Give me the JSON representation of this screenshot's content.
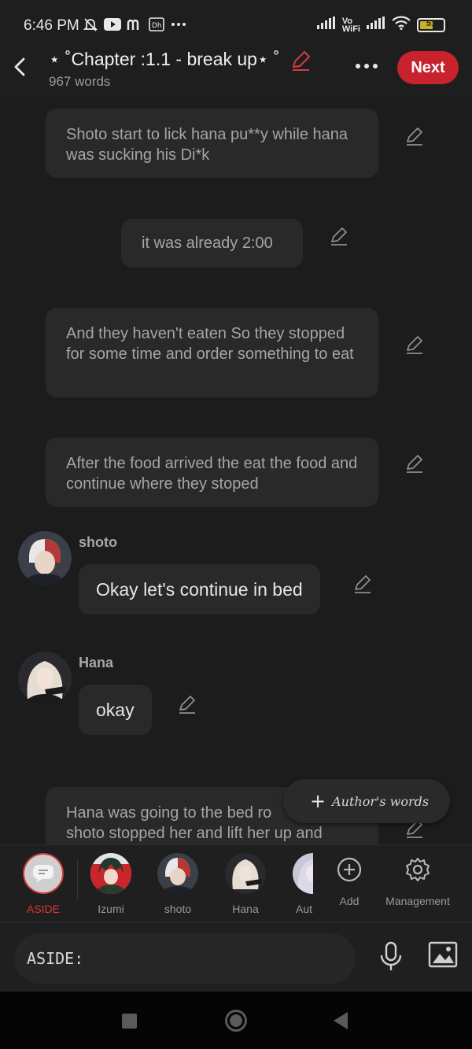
{
  "status_bar": {
    "time": "6:46 PM",
    "vowifi": "Vo\nWiFi",
    "battery": "51",
    "left_icons": [
      "mute-bell-icon",
      "youtube-icon",
      "m-app-icon",
      "app-icon"
    ],
    "right_icons": [
      "signal-icon",
      "vowifi-icon",
      "signal-icon",
      "wifi-icon",
      "battery-icon"
    ]
  },
  "header": {
    "title": "⋆ ˚Chapter :1.1 - break up⋆ ˚",
    "word_count": "967 words",
    "next_label": "Next",
    "accent_color": "#c8232c"
  },
  "story": {
    "narrations": [
      "Shoto start to lick hana pu**y while hana was sucking his Di*k",
      "it was already 2:00",
      "And they haven't eaten So they stopped for some time and order something to eat",
      "After the food arrived the eat the food and continue where they stoped",
      "Hana was going to the bed ro\nshoto stopped her and lift her up and"
    ],
    "dialogues": [
      {
        "speaker": "shoto",
        "text": "Okay let's continue in bed"
      },
      {
        "speaker": "Hana",
        "text": "okay"
      }
    ]
  },
  "authors_words": "Author's words",
  "character_bar": {
    "items": [
      "ASIDE",
      "Izumi",
      "shoto",
      "Hana",
      "Aut"
    ],
    "add_label": "Add",
    "management_label": "Management"
  },
  "input": {
    "placeholder": "ASIDE:"
  }
}
